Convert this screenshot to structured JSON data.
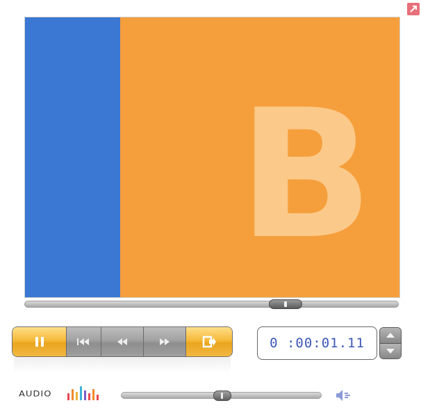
{
  "slide": {
    "letter": "B",
    "colors": {
      "left_panel": "#3a78d4",
      "right_panel": "#f59f3c",
      "letter": "#fbc98a"
    }
  },
  "player": {
    "seek_fraction": 0.695,
    "time_display": "0 :00:01.11",
    "audio_label": "AUDIO",
    "volume_fraction": 0.5,
    "buttons": [
      {
        "name": "pause",
        "icon": "pause-icon",
        "active": true
      },
      {
        "name": "skip-to-start",
        "icon": "skip-back-icon",
        "active": false
      },
      {
        "name": "rewind",
        "icon": "rewind-icon",
        "active": false
      },
      {
        "name": "fast-forward",
        "icon": "fast-forward-icon",
        "active": false
      },
      {
        "name": "exit",
        "icon": "exit-icon",
        "active": true
      }
    ],
    "accent_color": "#f5b93a",
    "time_text_color": "#3b57b8"
  }
}
